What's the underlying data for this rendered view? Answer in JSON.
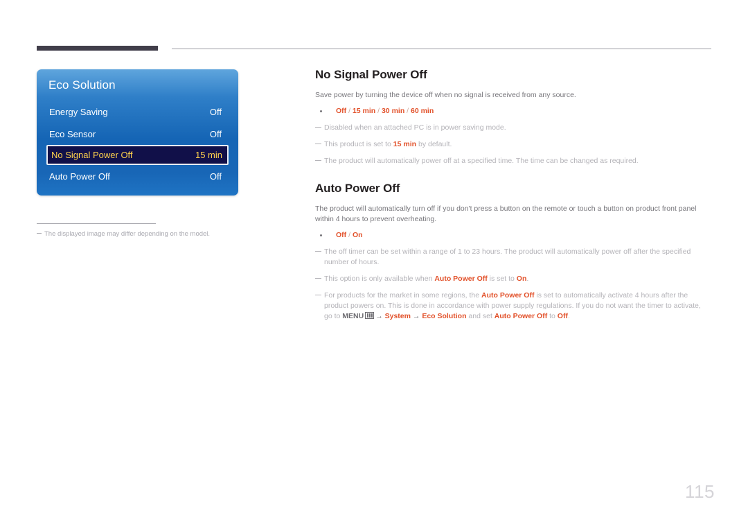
{
  "page": {
    "number": "115"
  },
  "osd": {
    "title": "Eco Solution",
    "rows": [
      {
        "label": "Energy Saving",
        "value": "Off",
        "selected": false
      },
      {
        "label": "Eco Sensor",
        "value": "Off",
        "selected": false
      },
      {
        "label": "No Signal Power Off",
        "value": "15 min",
        "selected": true
      },
      {
        "label": "Auto Power Off",
        "value": "Off",
        "selected": false
      }
    ],
    "footnote": "The displayed image may differ depending on the model."
  },
  "sections": [
    {
      "title": "No Signal Power Off",
      "body": "Save power by turning the device off when no signal is received from any source.",
      "option_parts": [
        {
          "text": "Off",
          "bold": true
        },
        {
          "text": " / ",
          "bold": false
        },
        {
          "text": "15 min",
          "bold": true
        },
        {
          "text": " / ",
          "bold": false
        },
        {
          "text": "30 min",
          "bold": true
        },
        {
          "text": " / ",
          "bold": false
        },
        {
          "text": "60 min",
          "bold": true
        }
      ],
      "notes": [
        "Disabled when an attached PC is in power saving mode.",
        "This product is set to 15 min by default.",
        "The product will automatically power off at a specified time. The time can be changed as required."
      ]
    },
    {
      "title": "Auto Power Off",
      "body": "The product will automatically turn off if you don't press a button on the remote or touch a button on product front panel within 4 hours to prevent overheating.",
      "option_parts": [
        {
          "text": "Off",
          "bold": true
        },
        {
          "text": " / ",
          "bold": false
        },
        {
          "text": "On",
          "bold": true
        }
      ],
      "notes": [
        "The off timer can be set within a range of 1 to 23 hours. The product will automatically power off after the specified number of hours.",
        "This option is only available when Auto Power Off is set to On.",
        "For products for the market in some regions, the Auto Power Off is set to automatically activate 4 hours after the product powers on. This is done in accordance with power supply regulations. If you do not want the timer to activate, go to MENU → System → Eco Solution and set Auto Power Off to Off."
      ]
    }
  ],
  "note_fragments": {
    "n1_pre": "Disabled when an attached PC is in power saving mode.",
    "n2_pre": "This product is set to ",
    "n2_hl": "15 min",
    "n2_post": " by default.",
    "n3_pre": "The product will automatically power off at a specified time. The time can be changed as required.",
    "n4_pre": "The off timer can be set within a range of 1 to 23 hours. The product will automatically power off after the specified number of hours.",
    "n5_pre": "This option is only available when ",
    "n5_hl1": "Auto Power Off",
    "n5_mid": " is set to ",
    "n5_hl2": "On",
    "n5_post": ".",
    "n6_pre": "For products for the market in some regions, the ",
    "n6_hl1": "Auto Power Off",
    "n6_mid": " is set to automatically activate 4 hours after the product powers on. This is done in accordance with power supply regulations. If you do not want the timer to activate, go to ",
    "n6_menu": "MENU",
    "n6_arrow1": "→",
    "n6_sys": "System",
    "n6_arrow2": "→",
    "n6_eco": "Eco Solution",
    "n6_and": " and set ",
    "n6_hl2": "Auto Power Off",
    "n6_to": " to ",
    "n6_hl3": "Off",
    "n6_end": "."
  },
  "icons": {
    "menu": "menu-grid-icon",
    "bullet": "bullet-dot-icon",
    "note_dash": "em-dash-icon"
  },
  "colors": {
    "accent_orange": "#e2512a",
    "panel_blue_top": "#5fa5dd",
    "panel_blue_bottom": "#1f74c4",
    "selected_row_bg": "#111049",
    "selected_row_text": "#ffd24d",
    "heading": "#231f20",
    "body_text": "#77767b",
    "note_text": "#b4b3b8",
    "rule_dark": "#413e4a",
    "page_number": "#d5d4d8"
  }
}
